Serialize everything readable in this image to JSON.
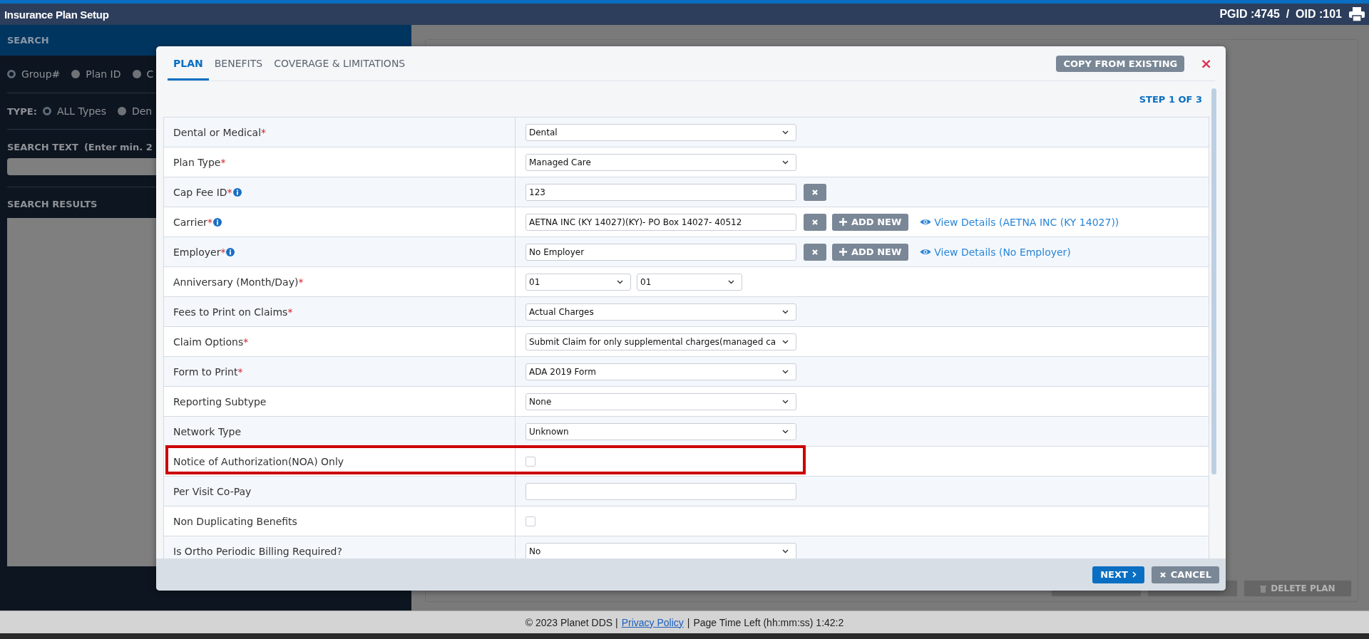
{
  "header": {
    "title": "Insurance Plan Setup",
    "ids": "PGID :4745  /  OID :101"
  },
  "sidebar": {
    "heading": "SEARCH",
    "search_by": [
      {
        "label": "Group#",
        "selected": true
      },
      {
        "label": "Plan ID",
        "selected": false
      },
      {
        "label": "C",
        "selected": false
      }
    ],
    "type_label": "TYPE:",
    "types": [
      {
        "label": "ALL Types",
        "selected": true
      },
      {
        "label": "Den",
        "selected": false
      }
    ],
    "search_text_label": "SEARCH TEXT",
    "search_text_hint": "(Enter min. 2",
    "results_label": "SEARCH RESULTS"
  },
  "background_buttons": [
    {
      "kind": "blank"
    },
    {
      "kind": "blank"
    },
    {
      "kind": "labeled",
      "label": "DELETE PLAN"
    }
  ],
  "dialog": {
    "tabs": [
      {
        "label": "PLAN",
        "selected": true
      },
      {
        "label": "BENEFITS",
        "selected": false
      },
      {
        "label": "COVERAGE & LIMITATIONS",
        "selected": false
      }
    ],
    "copy_button": "COPY FROM EXISTING",
    "close": "×",
    "step": "STEP 1 OF 3",
    "rows": [
      {
        "label": "Dental or Medical",
        "mark": "*",
        "info": false,
        "highlighted": false,
        "kind": "select",
        "value": "Dental"
      },
      {
        "label": "Plan Type",
        "mark": "*",
        "info": false,
        "highlighted": false,
        "kind": "select",
        "value": "Managed Care"
      },
      {
        "label": "Cap Fee ID",
        "mark": "*",
        "info": true,
        "highlighted": false,
        "kind": "clearable",
        "value": "123"
      },
      {
        "label": "Carrier",
        "mark": "*",
        "info": true,
        "highlighted": false,
        "kind": "lookup",
        "value": "AETNA INC (KY 14027)(KY)- PO Box 14027- 40512",
        "add_label": "ADD NEW",
        "link": "View Details (AETNA INC (KY 14027))"
      },
      {
        "label": "Employer",
        "mark": "*",
        "info": true,
        "highlighted": false,
        "kind": "lookup",
        "value": "No Employer",
        "add_label": "ADD NEW",
        "link": "View Details (No Employer)"
      },
      {
        "label": "Anniversary (Month/Day)",
        "mark": "*",
        "info": false,
        "highlighted": false,
        "kind": "pair",
        "value": "01",
        "value2": "01"
      },
      {
        "label": "Fees to Print on Claims",
        "mark": "*",
        "info": false,
        "highlighted": false,
        "kind": "select",
        "value": "Actual Charges"
      },
      {
        "label": "Claim Options",
        "mark": "*",
        "info": false,
        "highlighted": false,
        "kind": "select",
        "value": "Submit Claim for only supplemental charges(managed ca"
      },
      {
        "label": "Form to Print",
        "mark": "*",
        "info": false,
        "highlighted": false,
        "kind": "select",
        "value": "ADA 2019 Form"
      },
      {
        "label": "Reporting Subtype",
        "info": false,
        "highlighted": false,
        "kind": "select",
        "value": "None"
      },
      {
        "label": "Network Type",
        "info": false,
        "highlighted": false,
        "kind": "select",
        "value": "Unknown"
      },
      {
        "label": "Notice of Authorization(NOA) Only",
        "info": false,
        "highlighted": true,
        "kind": "checkbox",
        "checked": false
      },
      {
        "label": "Per Visit Co-Pay",
        "info": false,
        "highlighted": false,
        "kind": "text"
      },
      {
        "label": "Non Duplicating Benefits",
        "info": false,
        "highlighted": false,
        "kind": "checkbox",
        "checked": false
      },
      {
        "label": "Is Ortho Periodic Billing Required?",
        "info": false,
        "highlighted": false,
        "kind": "select",
        "value": "No"
      }
    ],
    "next_button": "NEXT",
    "cancel_button": "CANCEL"
  },
  "footer": {
    "copyright": "© 2023 Planet DDS |",
    "privacy_link": "Privacy Policy",
    "separator": "|",
    "time_left": "Page Time Left (hh:mm:ss) 1:42:2"
  }
}
